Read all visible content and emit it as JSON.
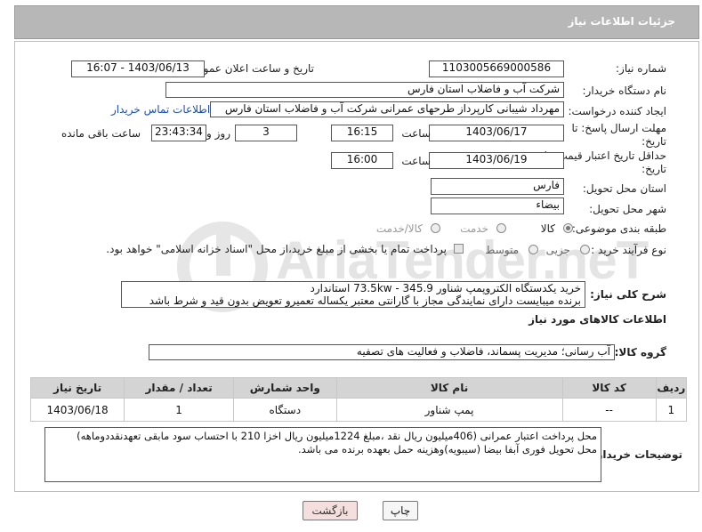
{
  "header": {
    "title": "جزئیات اطلاعات نیاز"
  },
  "fields": {
    "need_number_label": "شماره نیاز:",
    "need_number": "1103005669000586",
    "announce_label": "تاریخ و ساعت اعلان عمومی:",
    "announce_value": "1403/06/13 - 16:07",
    "buyer_org_label": "نام دستگاه خریدار:",
    "buyer_org": "شرکت آب و فاضلاب استان فارس",
    "creator_label": "ایجاد کننده درخواست:",
    "creator": "مهرداد شیبانی کارپرداز طرحهای عمرانی  شرکت آب و فاضلاب استان فارس",
    "contact_link": "اطلاعات تماس خریدار",
    "deadline_label_1": "مهلت ارسال پاسخ: تا",
    "deadline_label_2": "تاریخ:",
    "deadline_date": "1403/06/17",
    "time_label": "ساعت",
    "deadline_time": "16:15",
    "days_value": "3",
    "days_label": "روز و",
    "remaining_time": "23:43:34",
    "remaining_label": "ساعت باقی مانده",
    "validity_label_1": "حداقل تاریخ اعتبار قیمت: تا",
    "validity_label_2": "تاریخ:",
    "validity_date": "1403/06/19",
    "validity_time": "16:00",
    "province_label": "استان محل تحویل:",
    "province": "فارس",
    "city_label": "شهر محل تحویل:",
    "city": "بیضاء",
    "category_label": "طبقه بندی موضوعی:",
    "category_options": [
      "کالا",
      "خدمت",
      "کالا/خدمت"
    ],
    "purchase_type_label": "نوع فرآیند خرید :",
    "purchase_options": [
      "جزیی",
      "متوسط"
    ],
    "payment_note": "پرداخت تمام یا بخشی از مبلغ خرید،از محل \"اسناد خزانه اسلامی\" خواهد بود.",
    "summary_label": "شرح کلی نیاز:",
    "summary_line1": "خرید یکدستگاه الکتروپمپ شناور 345.9 - 73.5kw استاندارد",
    "summary_line2": "برنده میبایست دارای نمایندگی مجاز با گارانتی معتبر یکساله تعمیرو تعویض بدون قید و شرط باشد",
    "goods_info_title": "اطلاعات کالاهای مورد نیاز",
    "goods_group_label": "گروه کالا:",
    "goods_group": "آب رسانی؛ مدیریت پسماند، فاضلاب و فعالیت های تصفیه",
    "buyer_notes_label": "توضیحات خریدار:",
    "buyer_notes_line1": "محل پرداخت اعتبار عمرانی (406میلیون ریال نقد ،مبلغ 1224میلیون ریال اخزا 210 با احتساب سود مابقی تعهدنقددوماهه)",
    "buyer_notes_line2": "محل تحویل فوری آبفا بیضا (سیبویه)وهزینه حمل بعهده برنده می باشد."
  },
  "table": {
    "headers": [
      "ردیف",
      "کد کالا",
      "نام کالا",
      "واحد شمارش",
      "تعداد / مقدار",
      "تاریخ نیاز"
    ],
    "rows": [
      [
        "1",
        "--",
        "پمپ شناور",
        "دستگاه",
        "1",
        "1403/06/18"
      ]
    ]
  },
  "buttons": {
    "print": "چاپ",
    "back": "بازگشت"
  },
  "watermark": {
    "text": "AriaTender.neT"
  },
  "colors": {
    "header_bg": "#b7b7b7",
    "link": "#1a4fb3",
    "back_button_bg": "#f4dede"
  }
}
